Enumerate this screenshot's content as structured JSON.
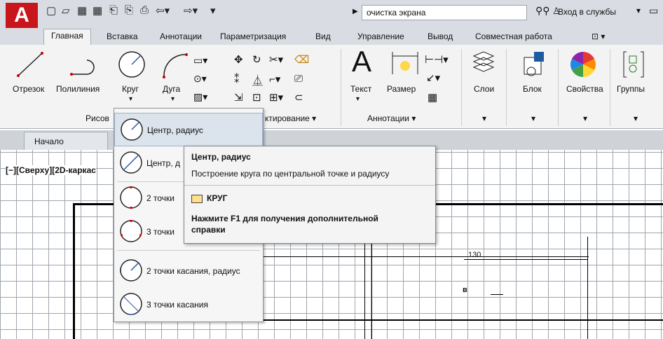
{
  "titlebar": {
    "logo": "A",
    "quick_access": [
      "□",
      "⊳",
      "■",
      "■",
      "↳",
      "⎘",
      "🖶",
      "⇦ ▾",
      "⇨ ▾",
      "▾"
    ],
    "search_placeholder": "очистка экрана",
    "signin": "Вход в службы",
    "binoculars_icon": "binoculars-icon",
    "user_icon": "user-icon"
  },
  "ribbon": {
    "tabs": [
      "Главная",
      "Вставка",
      "Аннотации",
      "Параметризация",
      "Вид",
      "Управление",
      "Вывод",
      "Совместная работа",
      "⊡ ▾"
    ],
    "active_tab": "Главная",
    "tools": [
      {
        "label": "Отрезок",
        "icon": "line-icon"
      },
      {
        "label": "Полилиния",
        "icon": "polyline-icon"
      },
      {
        "label": "Круг",
        "icon": "circle-icon"
      },
      {
        "label": "Дуга",
        "icon": "arc-icon"
      },
      {
        "label": "Текст",
        "icon": "text-icon"
      },
      {
        "label": "Размер",
        "icon": "dimension-icon"
      },
      {
        "label": "Слои",
        "icon": "layers-icon"
      },
      {
        "label": "Блок",
        "icon": "block-icon"
      },
      {
        "label": "Свойства",
        "icon": "properties-icon"
      },
      {
        "label": "Группы",
        "icon": "groups-icon"
      }
    ],
    "panel_footers": [
      "Рисов",
      "ктирование ▾",
      "Аннотации ▾",
      "▾",
      "▾",
      "▾",
      "▾"
    ]
  },
  "doc": {
    "tab": "Начало",
    "view_label": "[−][Сверху][2D-каркас"
  },
  "drawing": {
    "dim_130": "130",
    "label_B": "в"
  },
  "dropdown": {
    "items": [
      {
        "label": "Центр, радиус",
        "selected": true
      },
      {
        "label": "Центр, д",
        "selected": false
      },
      {
        "label": "2 точки",
        "selected": false
      },
      {
        "label": "3 точки",
        "selected": false
      },
      {
        "label": "2 точки касания, радиус",
        "selected": false
      },
      {
        "label": "3 точки касания",
        "selected": false
      }
    ]
  },
  "tooltip": {
    "title": "Центр, радиус",
    "description": "Построение круга по центральной точке и радиусу",
    "command": "КРУГ",
    "help": "Нажмите F1 для получения дополнительной справки"
  }
}
